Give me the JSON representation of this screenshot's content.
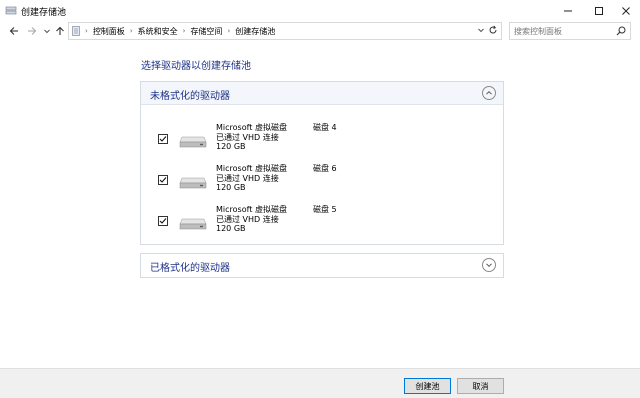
{
  "window": {
    "title": "创建存储池",
    "minimize_icon": "minimize-icon",
    "maximize_icon": "maximize-icon",
    "close_icon": "close-icon"
  },
  "nav": {
    "back_icon": "arrow-left-icon",
    "forward_icon": "arrow-right-icon",
    "recent_icon": "chevron-down-icon",
    "up_icon": "arrow-up-icon",
    "breadcrumbs": [
      "控制面板",
      "系统和安全",
      "存储空间",
      "创建存储池"
    ],
    "search_placeholder": "搜索控制面板"
  },
  "main": {
    "heading": "选择驱动器以创建存储池",
    "unformatted_group": {
      "title": "未格式化的驱动器",
      "expanded": true,
      "drives": [
        {
          "name": "Microsoft 虚拟磁盘",
          "connection": "已通过 VHD 连接",
          "size": "120 GB",
          "label": "磁盘 4",
          "checked": true
        },
        {
          "name": "Microsoft 虚拟磁盘",
          "connection": "已通过 VHD 连接",
          "size": "120 GB",
          "label": "磁盘 6",
          "checked": true
        },
        {
          "name": "Microsoft 虚拟磁盘",
          "connection": "已通过 VHD 连接",
          "size": "120 GB",
          "label": "磁盘 5",
          "checked": true
        }
      ]
    },
    "formatted_group": {
      "title": "已格式化的驱动器",
      "expanded": false
    }
  },
  "footer": {
    "create_label": "创建池",
    "cancel_label": "取消"
  },
  "colors": {
    "link_blue": "#1e3287",
    "group_header_bg": "#f3f6fb",
    "footer_bg": "#f0f0f0",
    "default_button_border": "#0078d7"
  }
}
